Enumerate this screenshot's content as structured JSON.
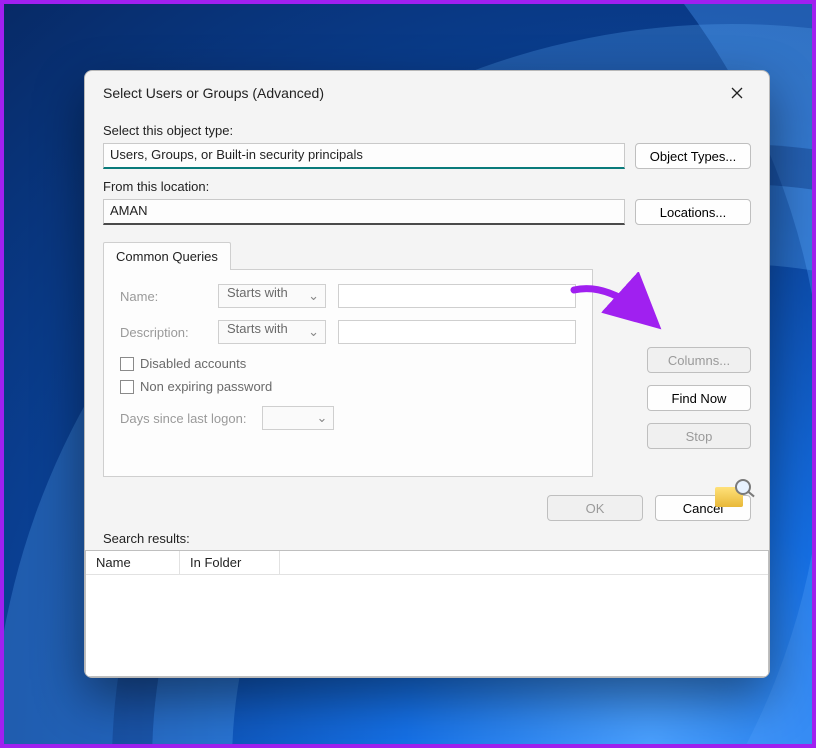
{
  "dialog": {
    "title": "Select Users or Groups (Advanced)",
    "object_type_label": "Select this object type:",
    "object_type_value": "Users, Groups, or Built-in security principals",
    "object_types_btn": "Object Types...",
    "location_label": "From this location:",
    "location_value": "AMAN",
    "locations_btn": "Locations...",
    "tab_label": "Common Queries",
    "name_label": "Name:",
    "name_match": "Starts with",
    "desc_label": "Description:",
    "desc_match": "Starts with",
    "disabled_label": "Disabled accounts",
    "nonexp_label": "Non expiring password",
    "days_label": "Days since last logon:",
    "columns_btn": "Columns...",
    "findnow_btn": "Find Now",
    "stop_btn": "Stop",
    "ok_btn": "OK",
    "cancel_btn": "Cancel",
    "results_label": "Search results:",
    "col_name": "Name",
    "col_folder": "In Folder"
  }
}
